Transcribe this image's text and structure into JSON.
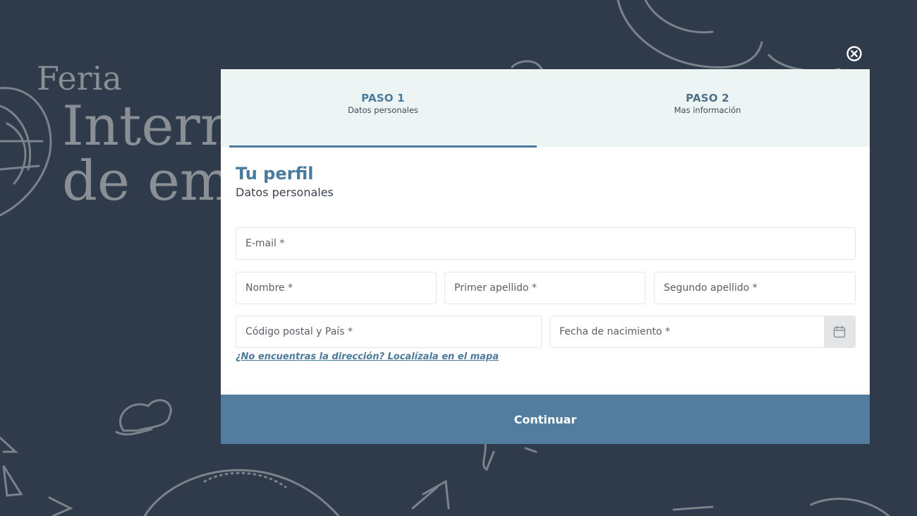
{
  "background": {
    "title_lines": [
      "Feria",
      "Intern",
      "de em"
    ]
  },
  "modal": {
    "close_icon": "close-circle-icon",
    "steps": [
      {
        "title": "PASO 1",
        "subtitle": "Datos personales",
        "active": true
      },
      {
        "title": "PASO 2",
        "subtitle": "Mas información",
        "active": false
      }
    ],
    "heading": "Tu perfil",
    "subheading": "Datos personales",
    "fields": {
      "email": {
        "placeholder": "E-mail *",
        "value": ""
      },
      "nombre": {
        "placeholder": "Nombre *",
        "value": ""
      },
      "primer_apellido": {
        "placeholder": "Primer apellido *",
        "value": ""
      },
      "segundo_apellido": {
        "placeholder": "Segundo apellido *",
        "value": ""
      },
      "codigo_postal_pais": {
        "placeholder": "Código postal y País *",
        "value": ""
      },
      "fecha_nacimiento": {
        "placeholder": "Fecha de nacimiento *",
        "value": "",
        "icon": "calendar-icon"
      }
    },
    "map_link": "¿No encuentras la dirección? Localízala en el mapa",
    "continue_label": "Continuar"
  },
  "colors": {
    "background": "#2f3a4b",
    "accent": "#4b7b9c",
    "button": "#527d9e",
    "steps_bg": "#edf5f4"
  }
}
